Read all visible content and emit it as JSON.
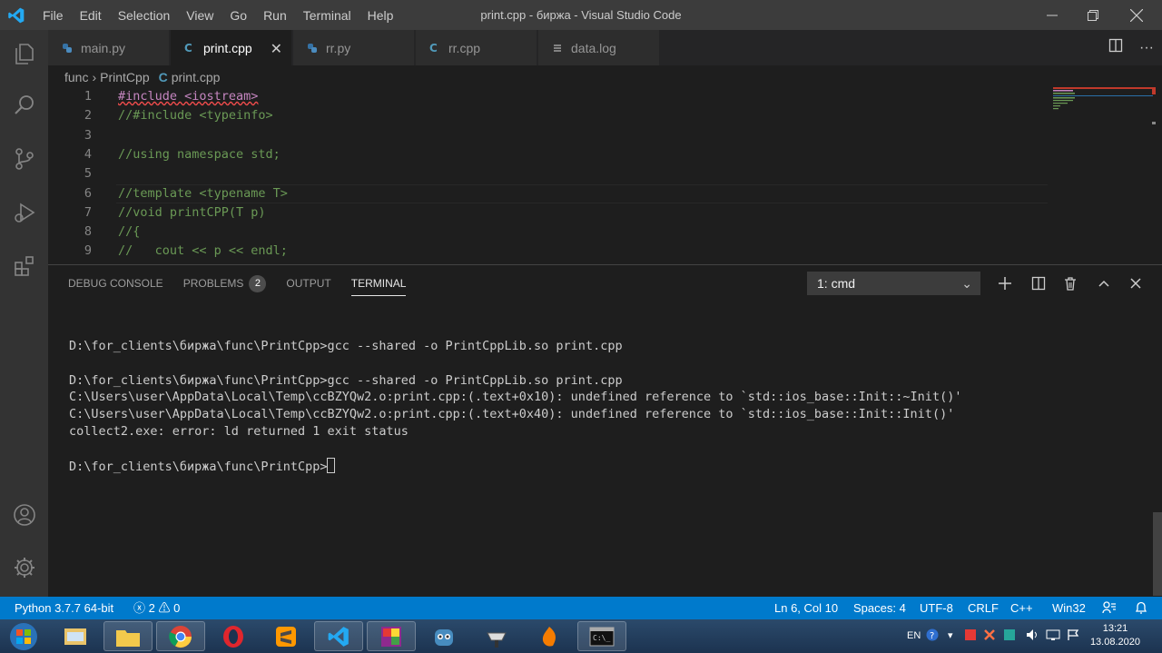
{
  "window": {
    "title": "print.cpp - биржа - Visual Studio Code",
    "menu": [
      "File",
      "Edit",
      "Selection",
      "View",
      "Go",
      "Run",
      "Terminal",
      "Help"
    ]
  },
  "tabs": [
    {
      "label": "main.py",
      "icon": "python-icon",
      "active": false
    },
    {
      "label": "print.cpp",
      "icon": "cpp-icon",
      "active": true
    },
    {
      "label": "rr.py",
      "icon": "python-icon",
      "active": false
    },
    {
      "label": "rr.cpp",
      "icon": "cpp-icon",
      "active": false
    },
    {
      "label": "data.log",
      "icon": "log-file-icon",
      "active": false
    }
  ],
  "breadcrumb": [
    "func",
    "PrintCpp",
    "print.cpp"
  ],
  "editor": {
    "lines": [
      {
        "n": "1",
        "text": "#include <iostream>"
      },
      {
        "n": "2",
        "text": "//#include <typeinfo>"
      },
      {
        "n": "3",
        "text": ""
      },
      {
        "n": "4",
        "text": "//using namespace std;"
      },
      {
        "n": "5",
        "text": ""
      },
      {
        "n": "6",
        "text": "//template <typename T>"
      },
      {
        "n": "7",
        "text": "//void printCPP(T p)"
      },
      {
        "n": "8",
        "text": "//{"
      },
      {
        "n": "9",
        "text": "//   cout << p << endl;"
      }
    ]
  },
  "panel": {
    "tabs": [
      "DEBUG CONSOLE",
      "PROBLEMS",
      "OUTPUT",
      "TERMINAL"
    ],
    "problems_count": "2",
    "terminal_select": "1: cmd",
    "terminal_lines": [
      "D:\\for_clients\\биржа\\func\\PrintCpp>gcc --shared -o PrintCppLib.so print.cpp",
      "",
      "D:\\for_clients\\биржа\\func\\PrintCpp>gcc --shared -o PrintCppLib.so print.cpp",
      "C:\\Users\\user\\AppData\\Local\\Temp\\ccBZYQw2.o:print.cpp:(.text+0x10): undefined reference to `std::ios_base::Init::~Init()'",
      "C:\\Users\\user\\AppData\\Local\\Temp\\ccBZYQw2.o:print.cpp:(.text+0x40): undefined reference to `std::ios_base::Init::Init()'",
      "collect2.exe: error: ld returned 1 exit status",
      ""
    ],
    "prompt": "D:\\for_clients\\биржа\\func\\PrintCpp>"
  },
  "statusbar": {
    "python": "Python 3.7.7 64-bit",
    "errors": "2",
    "warnings": "0",
    "position": "Ln 6, Col 10",
    "spaces": "Spaces: 4",
    "encoding": "UTF-8",
    "eol": "CRLF",
    "language": "C++",
    "platform": "Win32"
  },
  "taskbar": {
    "lang": "EN",
    "time": "13:21",
    "date": "13.08.2020"
  },
  "colors": {
    "accent": "#007acc",
    "comment": "#6a9955",
    "keyword": "#c586c0",
    "string": "#ce9178"
  }
}
